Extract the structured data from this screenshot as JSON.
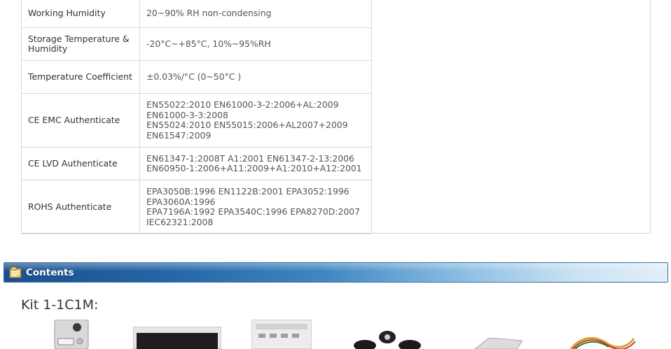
{
  "spec_rows": [
    {
      "key": "Working Humidity",
      "value": [
        "20~90% RH non-condensing"
      ]
    },
    {
      "key": "Storage Temperature & Humidity",
      "value": [
        "-20°C~+85°C, 10%~95%RH"
      ]
    },
    {
      "key": "Temperature Coefficient",
      "value": [
        "±0.03%/°C (0~50°C )"
      ]
    },
    {
      "key": "CE EMC Authenticate",
      "value": [
        "EN55022:2010 EN61000-3-2:2006+AL:2009",
        "EN61000-3-3:2008",
        "EN55024:2010 EN55015:2006+AL2007+2009",
        "EN61547:2009"
      ]
    },
    {
      "key": "CE LVD Authenticate",
      "value": [
        "EN61347-1:2008T A1:2001 EN61347-2-13:2006",
        "EN60950-1:2006+A11:2009+A1:2010+A12:2001"
      ]
    },
    {
      "key": "ROHS Authenticate",
      "value": [
        "EPA3050B:1996 EN1122B:2001 EPA3052:1996",
        "EPA3060A:1996",
        "EPA7196A:1992 EPA3540C:1996 EPA8270D:2007",
        "IEC62321:2008"
      ]
    }
  ],
  "section": {
    "title": "Contents",
    "icon": "folder-icon"
  },
  "kit": {
    "title": "Kit 1-1C1M:"
  },
  "products": [
    {
      "name": "door-station",
      "icon": "door-station-icon"
    },
    {
      "name": "indoor-monitor",
      "icon": "monitor-icon"
    },
    {
      "name": "power-supply",
      "icon": "power-supply-icon"
    },
    {
      "name": "mounting-brackets",
      "icon": "bracket-icon"
    },
    {
      "name": "rain-cover",
      "icon": "cover-icon"
    },
    {
      "name": "cable",
      "icon": "cable-icon"
    }
  ]
}
